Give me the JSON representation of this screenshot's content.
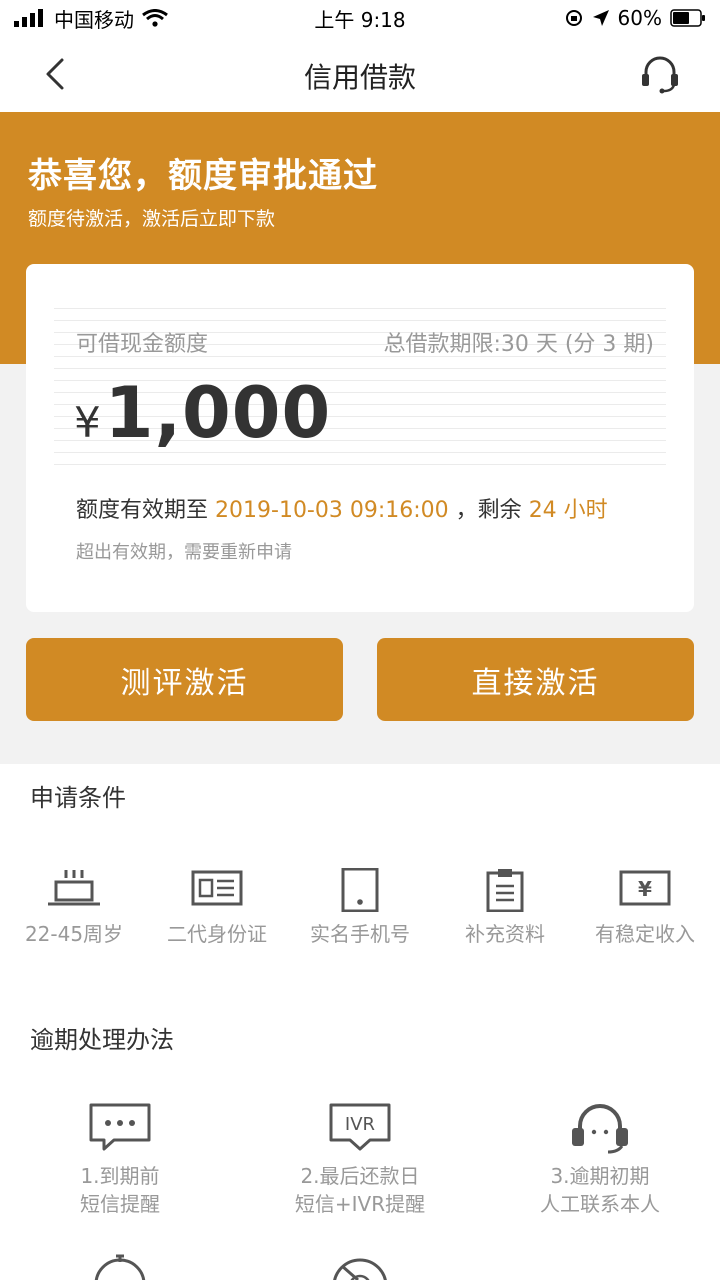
{
  "status_bar": {
    "carrier": "中国移动",
    "time": "上午 9:18",
    "battery": "60%"
  },
  "nav": {
    "title": "信用借款",
    "back_icon": "chevron-left-icon",
    "service_icon": "headset-icon"
  },
  "hero": {
    "title": "恭喜您，额度审批通过",
    "subtitle": "额度待激活，激活后立即下款"
  },
  "card": {
    "credit_label": "可借现金额度",
    "term_label": "总借款期限:30 天 (分 3 期)",
    "currency": "¥",
    "amount": "1,000",
    "valid_prefix": "额度有效期至",
    "valid_date": "2019-10-03 09:16:00",
    "valid_sep": "，剩余",
    "valid_remaining": "24 小时",
    "note": "超出有效期，需要重新申请"
  },
  "actions": {
    "evaluate_label": "测评激活",
    "direct_label": "直接激活"
  },
  "conditions": {
    "title": "申请条件",
    "items": [
      {
        "label": "22-45周岁",
        "icon": "birthday-cake-icon"
      },
      {
        "label": "二代身份证",
        "icon": "id-card-icon"
      },
      {
        "label": "实名手机号",
        "icon": "phone-icon"
      },
      {
        "label": "补充资料",
        "icon": "clipboard-icon"
      },
      {
        "label": "有稳定收入",
        "icon": "income-icon"
      }
    ]
  },
  "overdue": {
    "title": "逾期处理办法",
    "items": [
      {
        "line1": "1.到期前",
        "line2": "短信提醒",
        "icon": "sms-icon"
      },
      {
        "line1": "2.最后还款日",
        "line2": "短信+IVR提醒",
        "icon": "ivr-icon",
        "icon_text": "IVR"
      },
      {
        "line1": "3.逾期初期",
        "line2": "人工联系本人",
        "icon": "headset-icon"
      }
    ]
  },
  "colors": {
    "accent": "#d18a24",
    "background": "#f2f2f2",
    "muted_text": "#999999"
  }
}
